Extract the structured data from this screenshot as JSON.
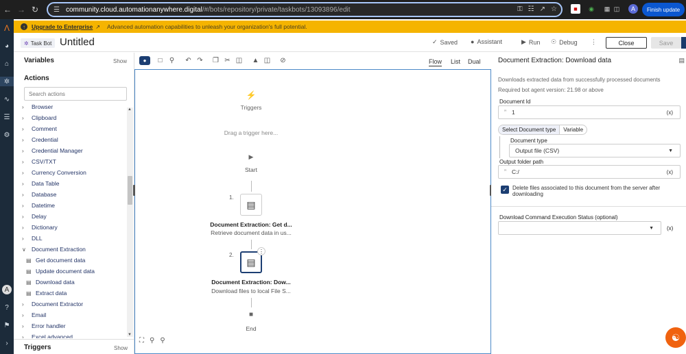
{
  "browser": {
    "url_host": "community.cloud.automationanywhere.digital",
    "url_path": "/#/bots/repository/private/taskbots/13093896/edit",
    "finish_update": "Finish update"
  },
  "banner": {
    "upgrade_link": "Upgrade to Enterprise",
    "description": "Advanced automation capabilities to unleash your organization's full potential."
  },
  "header": {
    "tag": "Task Bot",
    "title": "Untitled",
    "saved": "Saved",
    "assistant": "Assistant",
    "run": "Run",
    "debug": "Debug",
    "close": "Close",
    "save": "Save"
  },
  "left": {
    "variables": "Variables",
    "show": "Show",
    "actions": "Actions",
    "search_placeholder": "Search actions",
    "triggers": "Triggers",
    "items": [
      "Browser",
      "Clipboard",
      "Comment",
      "Credential",
      "Credential Manager",
      "CSV/TXT",
      "Currency Conversion",
      "Data Table",
      "Database",
      "Datetime",
      "Delay",
      "Dictionary",
      "DLL",
      "Document Extraction"
    ],
    "sub_items": [
      "Get document data",
      "Update document data",
      "Download data",
      "Extract data"
    ],
    "items_after": [
      "Document Extractor",
      "Email",
      "Error handler",
      "Excel advanced"
    ]
  },
  "canvas": {
    "tabs": [
      "Flow",
      "List",
      "Dual"
    ],
    "triggers_label": "Triggers",
    "drag_hint": "Drag a trigger here...",
    "start": "Start",
    "end": "End",
    "nodes": [
      {
        "num": "1.",
        "title": "Document Extraction: Get d...",
        "desc": "Retrieve document data in us..."
      },
      {
        "num": "2.",
        "title": "Document Extraction: Dow...",
        "desc": "Download files to local File S..."
      }
    ]
  },
  "right": {
    "title": "Document Extraction: Download data",
    "desc1": "Downloads extracted data from successfully processed documents",
    "desc2": "Required bot agent version: 21.98 or above",
    "doc_id_label": "Document Id",
    "doc_id_value": "1",
    "var_token": "(x)",
    "seg_select": "Select Document type",
    "seg_variable": "Variable",
    "doc_type_label": "Document type",
    "doc_type_value": "Output file (CSV)",
    "output_label": "Output folder path",
    "output_value": "C:/",
    "checkbox_label": "Delete files associated to this document from the server after downloading",
    "status_label": "Download Command Execution Status (optional)"
  }
}
